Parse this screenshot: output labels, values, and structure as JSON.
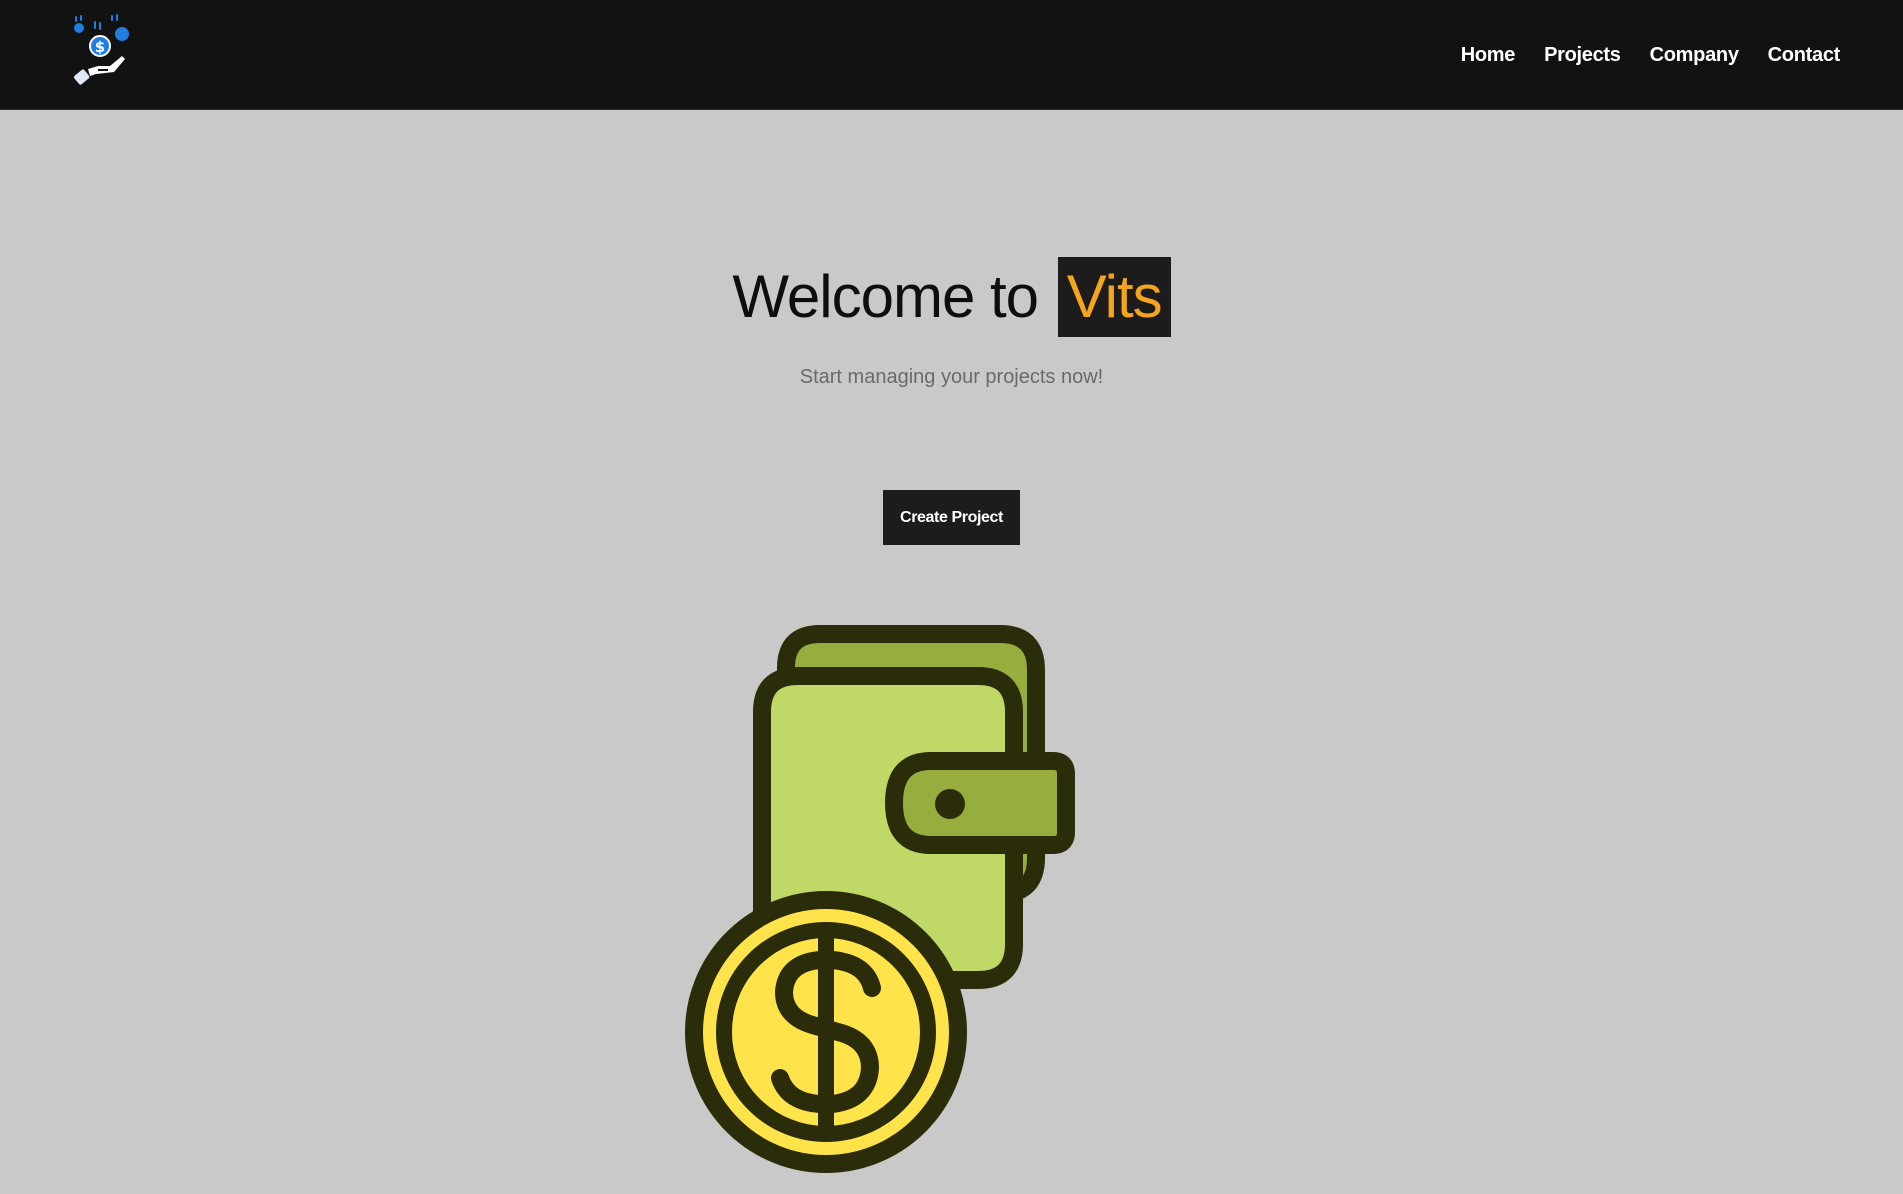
{
  "header": {
    "logo_icon": "hand-coins-icon",
    "nav": [
      {
        "label": "Home"
      },
      {
        "label": "Projects"
      },
      {
        "label": "Company"
      },
      {
        "label": "Contact"
      }
    ]
  },
  "hero": {
    "title_prefix": "Welcome to",
    "title_brand": "Vits",
    "subtitle": "Start managing your projects now!",
    "cta_label": "Create Project",
    "illustration_icon": "wallet-with-dollar-coin-icon"
  },
  "colors": {
    "navbar_bg": "#121212",
    "page_bg": "#c9c9c9",
    "brand_accent": "#f5a51d",
    "button_bg": "#1c1c1c",
    "logo_blue": "#1e7fe0",
    "wallet_green": "#bfd866",
    "wallet_dark_green": "#97ae3f",
    "coin_yellow": "#ffe34a",
    "outline_dark": "#2b2d0a"
  }
}
